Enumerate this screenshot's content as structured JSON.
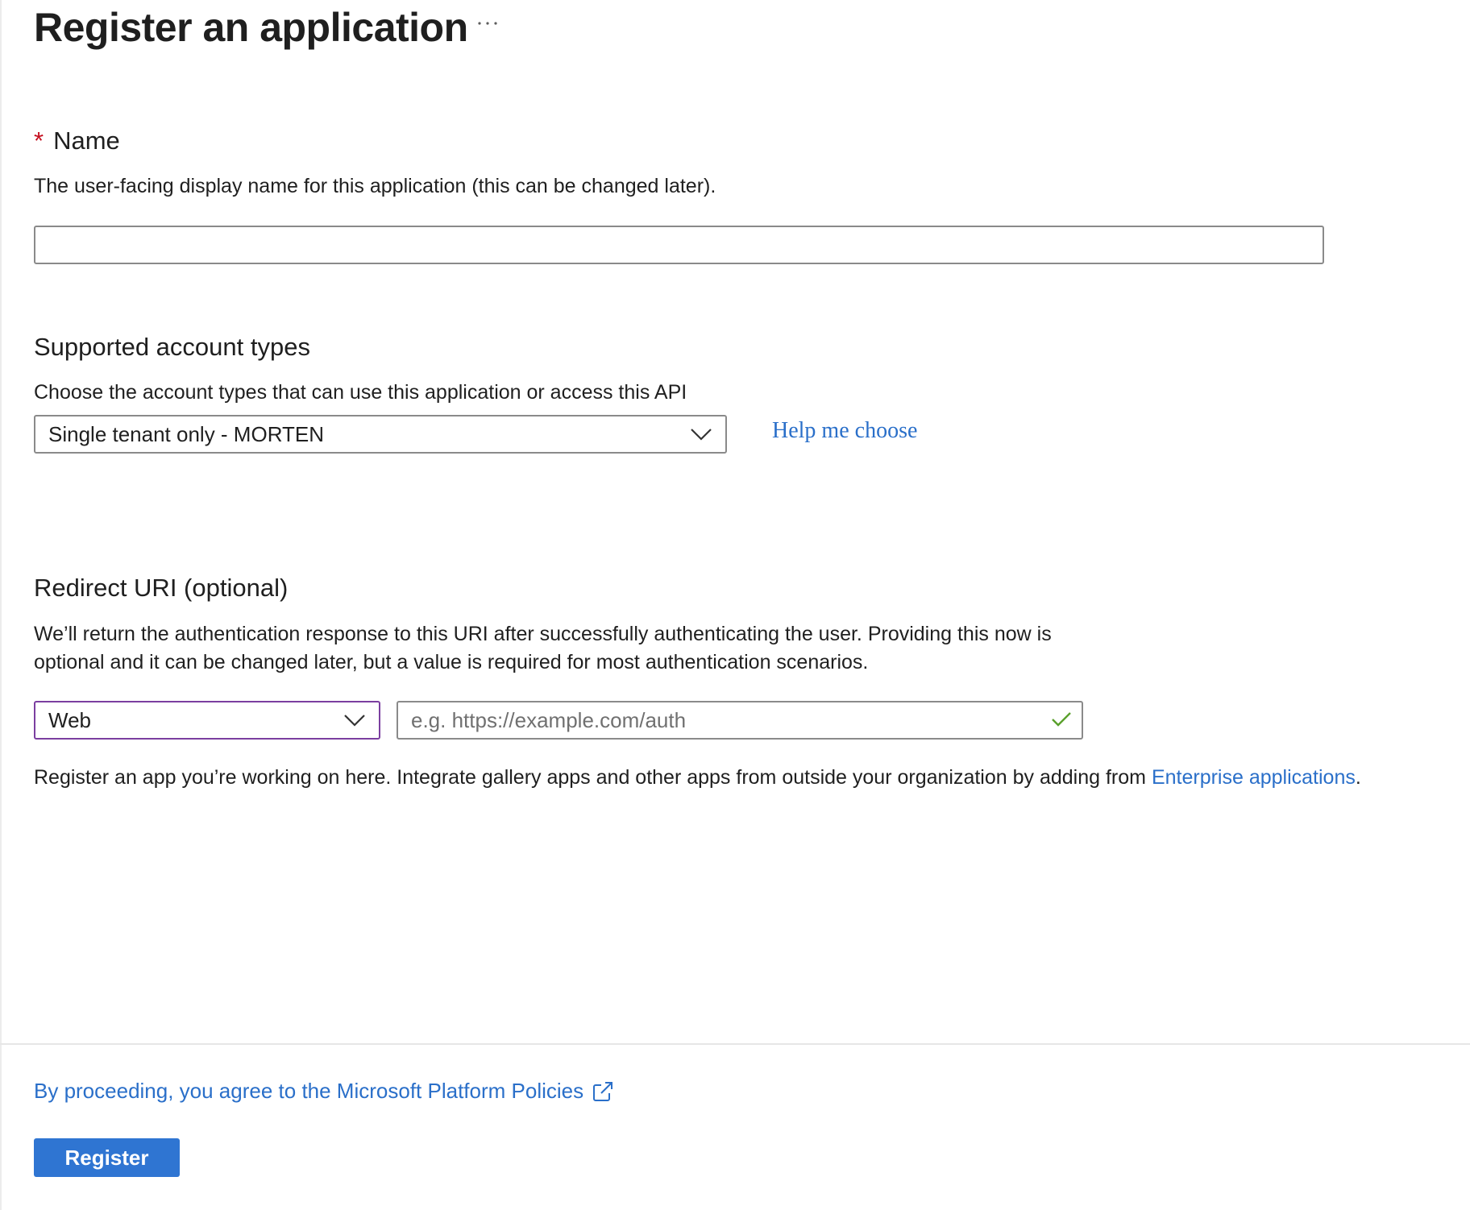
{
  "header": {
    "title": "Register an application",
    "more_icon": "more-horizontal-icon"
  },
  "name_section": {
    "required_marker": "*",
    "label": "Name",
    "description": "The user-facing display name for this application (this can be changed later).",
    "input_value": ""
  },
  "account_types_section": {
    "label": "Supported account types",
    "description": "Choose the account types that can use this application or access this API",
    "selected_value": "Single tenant only - MORTEN",
    "help_link": "Help me choose"
  },
  "redirect_section": {
    "label": "Redirect URI (optional)",
    "description_line1": "We’ll return the authentication response to this URI after successfully authenticating the user. Providing this now is",
    "description_line2": "optional and it can be changed later, but a value is required for most authentication scenarios.",
    "platform_selected": "Web",
    "uri_placeholder": "e.g. https://example.com/auth",
    "uri_value": "",
    "valid_icon": "check-icon",
    "note_prefix": "Register an app you’re working on here. Integrate gallery apps and other apps from outside your organization by adding from ",
    "note_link": "Enterprise applications",
    "note_suffix": "."
  },
  "footer": {
    "policy_link": "By proceeding, you agree to the Microsoft Platform Policies",
    "policy_icon": "external-link-icon",
    "register_label": "Register"
  },
  "colors": {
    "link": "#2a6fc9",
    "primary_button": "#2f75d2",
    "required": "#c50f1f",
    "focus_border": "#7b3fa0",
    "valid_check": "#5aa02c"
  }
}
